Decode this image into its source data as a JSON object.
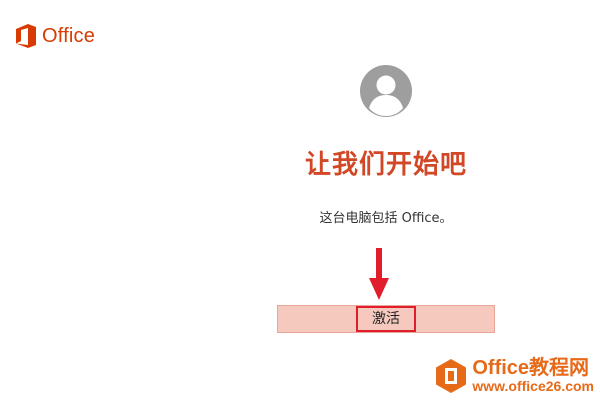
{
  "brand": {
    "name": "Office",
    "color": "#d83b01"
  },
  "avatar": {
    "icon": "user-avatar-icon"
  },
  "main": {
    "headline": "让我们开始吧",
    "description": "这台电脑包括 Office。",
    "activate_label": "激活"
  },
  "annotation": {
    "arrow_icon": "down-arrow-icon",
    "highlight_color": "#e01e2b"
  },
  "watermark": {
    "title": "Office教程网",
    "url": "www.office26.com"
  },
  "colors": {
    "accent": "#d24726",
    "button_fill": "#f6c9be"
  }
}
